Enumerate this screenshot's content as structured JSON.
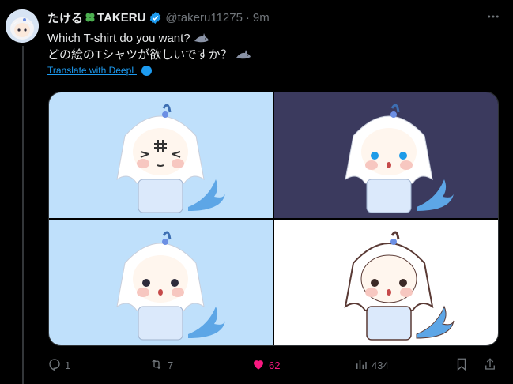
{
  "tweet": {
    "author": {
      "name": "たける",
      "name_suffix": "TAKERU",
      "handle": "@takeru11275",
      "time": "9m"
    },
    "text_lines": [
      "Which T-shirt do you want?",
      "どの絵のTシャツが欲しいですか？"
    ],
    "translate_label": "Translate with DeepL",
    "images": [
      {
        "bg": "#bfe0fb",
        "variant": "face-symbol"
      },
      {
        "bg": "#3b3a5e",
        "variant": "blue-eyes"
      },
      {
        "bg": "#bfe0fb",
        "variant": "dark-eyes"
      },
      {
        "bg": "#ffffff",
        "variant": "outline"
      }
    ],
    "actions": {
      "replies": "1",
      "reposts": "7",
      "likes": "62",
      "views": "434"
    }
  },
  "colors": {
    "accent": "#1d9bf0",
    "like": "#f91880",
    "muted": "#71767b"
  },
  "icons": [
    "avatar",
    "clover-icon",
    "verified-icon",
    "more-icon",
    "shark-emoji",
    "deepl-icon",
    "reply-icon",
    "repost-icon",
    "heart-icon",
    "views-icon",
    "bookmark-icon",
    "share-icon"
  ]
}
